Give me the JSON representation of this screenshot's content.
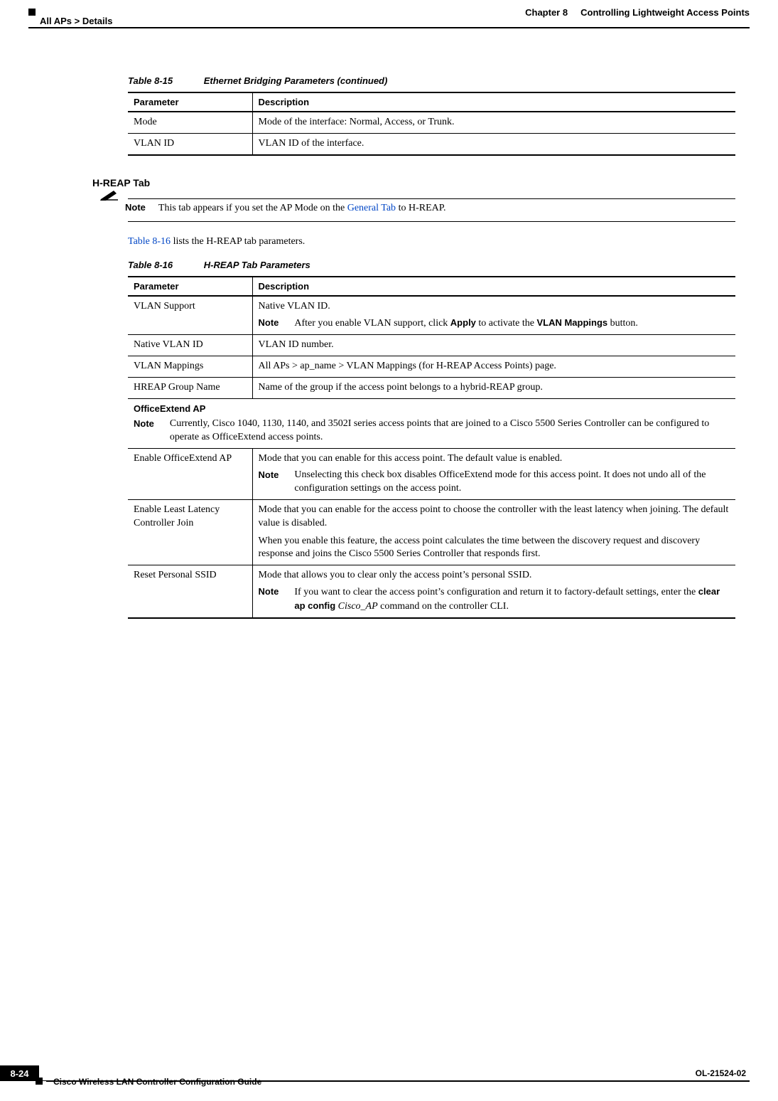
{
  "header": {
    "chapter_label": "Chapter 8",
    "chapter_title": "Controlling Lightweight Access Points",
    "breadcrumb": "All APs > Details"
  },
  "table_8_15": {
    "caption_num": "Table 8-15",
    "caption_title": "Ethernet Bridging Parameters (continued)",
    "col1": "Parameter",
    "col2": "Description",
    "rows": [
      {
        "param": "Mode",
        "desc": "Mode of the interface: Normal, Access, or Trunk."
      },
      {
        "param": "VLAN ID",
        "desc": "VLAN ID of the interface."
      }
    ]
  },
  "hreap_heading": "H-REAP Tab",
  "hreap_note": {
    "label": "Note",
    "prefix": "This tab appears if you set the AP Mode on the ",
    "link": "General Tab",
    "suffix": " to H-REAP."
  },
  "hreap_intro": {
    "link": "Table 8-16",
    "suffix": " lists the H-REAP tab parameters."
  },
  "table_8_16": {
    "caption_num": "Table 8-16",
    "caption_title": "H-REAP Tab Parameters",
    "col1": "Parameter",
    "col2": "Description",
    "rows": {
      "vlan_support": {
        "param": "VLAN Support",
        "desc_line": "Native VLAN ID.",
        "note_label": "Note",
        "note_prefix": "After you enable VLAN support, click ",
        "note_bold1": "Apply",
        "note_mid": " to activate the ",
        "note_bold2": "VLAN Mappings",
        "note_suffix": " button."
      },
      "native_vlan": {
        "param": "Native VLAN ID",
        "desc": "VLAN ID number."
      },
      "vlan_mappings": {
        "param": "VLAN Mappings",
        "desc": "All APs > ap_name > VLAN Mappings (for H-REAP Access Points) page."
      },
      "hreap_group": {
        "param": "HREAP Group Name",
        "desc": "Name of the group if the access point belongs to a hybrid-REAP group."
      },
      "officeextend_section": {
        "heading": "OfficeExtend AP",
        "note_label": "Note",
        "note_text": "Currently, Cisco 1040, 1130, 1140, and 3502I series access points that are joined to a Cisco 5500 Series Controller can be configured to operate as OfficeExtend access points."
      },
      "enable_oe": {
        "param": "Enable OfficeExtend AP",
        "desc_line": "Mode that you can enable for this access point. The default value is enabled.",
        "note_label": "Note",
        "note_text": "Unselecting this check box disables OfficeExtend mode for this access point. It does not undo all of the configuration settings on the access point."
      },
      "enable_least": {
        "param": "Enable Least Latency Controller Join",
        "desc_p1": "Mode that you can enable for the access point to choose the controller with the least latency when joining. The default value is disabled.",
        "desc_p2": "When you enable this feature, the access point calculates the time between the discovery request and discovery response and joins the Cisco 5500 Series Controller that responds first."
      },
      "reset_ssid": {
        "param": "Reset Personal SSID",
        "desc_line": "Mode that allows you to clear only the access point’s personal SSID.",
        "note_label": "Note",
        "note_prefix": "If you want to clear the access point’s configuration and return it to factory-default settings, enter the ",
        "note_bold": "clear ap config",
        "note_italic": " Cisco_AP",
        "note_suffix": " command on the controller CLI."
      }
    }
  },
  "footer": {
    "guide_title": "Cisco Wireless LAN Controller Configuration Guide",
    "page_num": "8-24",
    "doc_id": "OL-21524-02"
  },
  "chart_data": [
    {
      "type": "table",
      "title": "Table 8-15 Ethernet Bridging Parameters (continued)",
      "columns": [
        "Parameter",
        "Description"
      ],
      "rows": [
        [
          "Mode",
          "Mode of the interface: Normal, Access, or Trunk."
        ],
        [
          "VLAN ID",
          "VLAN ID of the interface."
        ]
      ]
    },
    {
      "type": "table",
      "title": "Table 8-16 H-REAP Tab Parameters",
      "columns": [
        "Parameter",
        "Description"
      ],
      "rows": [
        [
          "VLAN Support",
          "Native VLAN ID. Note: After you enable VLAN support, click Apply to activate the VLAN Mappings button."
        ],
        [
          "Native VLAN ID",
          "VLAN ID number."
        ],
        [
          "VLAN Mappings",
          "All APs > ap_name > VLAN Mappings (for H-REAP Access Points) page."
        ],
        [
          "HREAP Group Name",
          "Name of the group if the access point belongs to a hybrid-REAP group."
        ],
        [
          "OfficeExtend AP",
          "Note: Currently, Cisco 1040, 1130, 1140, and 3502I series access points that are joined to a Cisco 5500 Series Controller can be configured to operate as OfficeExtend access points."
        ],
        [
          "Enable OfficeExtend AP",
          "Mode that you can enable for this access point. The default value is enabled. Note: Unselecting this check box disables OfficeExtend mode for this access point. It does not undo all of the configuration settings on the access point."
        ],
        [
          "Enable Least Latency Controller Join",
          "Mode that you can enable for the access point to choose the controller with the least latency when joining. The default value is disabled. When you enable this feature, the access point calculates the time between the discovery request and discovery response and joins the Cisco 5500 Series Controller that responds first."
        ],
        [
          "Reset Personal SSID",
          "Mode that allows you to clear only the access point’s personal SSID. Note: If you want to clear the access point’s configuration and return it to factory-default settings, enter the clear ap config Cisco_AP command on the controller CLI."
        ]
      ]
    }
  ]
}
